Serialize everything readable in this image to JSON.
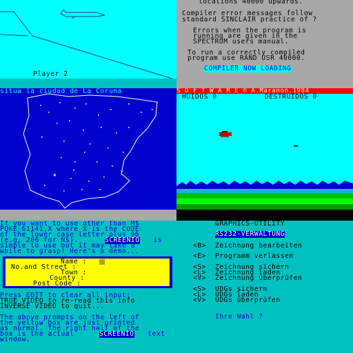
{
  "tl": {
    "player_label": "Player 2"
  },
  "tr": {
    "lines": [
      "locations 40000 upwards.",
      "",
      "Compiler error messages follow",
      "standard SINCLAIR practice of ?",
      "",
      "Errors when the program is",
      "running are given in the",
      "SPECTRUM users manual.",
      "",
      "To run a correctly compiled",
      "program use RAND USR 40000."
    ],
    "loading_label": "COMPILER NOW LOADING"
  },
  "ml": {
    "title": "situa la ciudad de La Coruna"
  },
  "mr": {
    "banner": "S O F T W A R E © A.Maranon.1984",
    "score_huidos": "HUIDOS 0",
    "score_destruidos": "DESTRUIDOS 0"
  },
  "bl": {
    "intro_lines": [
      "If you want to use other than M$",
      "POKE 61141,X where X is the CODE",
      "of the lower case letter plus 96",
      "(e.g. 206 for N$)."
    ],
    "screenio_word": "SCREENIO",
    "is_word": " is",
    "intro_tail": [
      "simple to use but it may take a",
      "while to grasp! Here's a demo..."
    ],
    "form_labels": [
      "Name :",
      "No.and Street :",
      "Town :",
      "County :",
      "Post Code :"
    ],
    "instr_lines": [
      "Press EDIT to clear all input;",
      "TRUE VIDEO to re-read this info",
      "INVERSE VIDEO to quit..."
    ],
    "outro_lines": [
      "The above prompts on the left of",
      "the yellow box are just printed",
      "as normal. The right half of the",
      "box is the actual"
    ],
    "outro_screenio": "SCREENIO",
    "outro_text": " text",
    "outro_last": "window."
  },
  "br": {
    "title": "GRAPHICS-UTILITY",
    "subtitle": "RS232-VERWALTUNG",
    "menu": [
      {
        "key": "<B>",
        "label": "Zeichnung bearbeiten"
      },
      {
        "key": "<E>",
        "label": "Programm verlassen"
      },
      {
        "key": "<S>",
        "label": "Zeichnung sichern"
      },
      {
        "key": "<L>",
        "label": "Zeichnung laden"
      },
      {
        "key": "<V>",
        "label": "Zeichnung überprüfen"
      },
      {
        "key": "<S>",
        "label": "UDGs sichern"
      },
      {
        "key": "<L>",
        "label": "UDGs laden"
      },
      {
        "key": "<V>",
        "label": "UDGs überprüfen"
      }
    ],
    "prompt": "Ihre Wahl ?"
  },
  "colors": {
    "cyan": "#00ffff",
    "gray": "#a8a8a8",
    "blue": "#0000cd",
    "spectrum_cyan": "#00c0c0",
    "yellow": "#ffff00",
    "red": "#ff0000",
    "green": "#00c000"
  }
}
